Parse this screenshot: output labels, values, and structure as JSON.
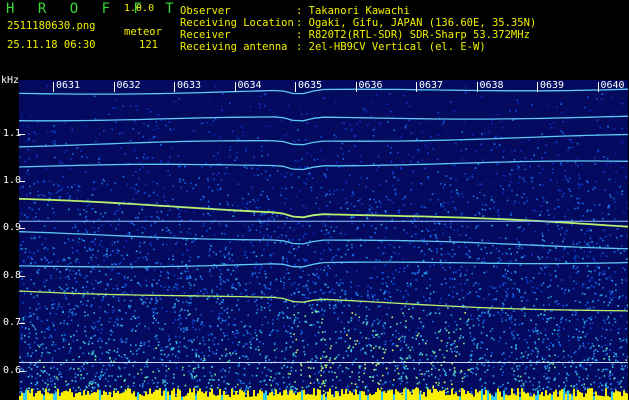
{
  "app": {
    "title": "HROFFT",
    "version": "1.0.0"
  },
  "file": {
    "name": "2511180630.png",
    "timestamp": "25.11.18 06:30"
  },
  "detection": {
    "mode_label": "meteor",
    "count": "121"
  },
  "info": [
    {
      "key": "Observer",
      "value": ": Takanori Kawachi"
    },
    {
      "key": "Receiving Location",
      "value": ": Ogaki, Gifu, JAPAN (136.60E, 35.35N)"
    },
    {
      "key": "Receiver",
      "value": ": R820T2(RTL-SDR) SDR-Sharp 53.372MHz"
    },
    {
      "key": "Receiving antenna",
      "value": ": 2el-HB9CV Vertical (el. E-W)"
    }
  ],
  "colors": {
    "background": "#000000",
    "header_green": "#38d838",
    "header_yellow": "#f0f000",
    "spectrum_low": "#0a1fa0",
    "spectrum_high": "#ffff40"
  },
  "chart_data": {
    "type": "heatmap",
    "ylabel": "kHz",
    "x_ticks": [
      "0631",
      "0632",
      "0633",
      "0634",
      "0635",
      "0636",
      "0637",
      "0638",
      "0639",
      "0640"
    ],
    "y_ticks": [
      "1.1",
      "1.0",
      "0.9",
      "0.8",
      "0.7",
      "0.6"
    ],
    "ylim": [
      0.58,
      1.19
    ],
    "grid": false,
    "traces_khz": [
      {
        "x": [
          0,
          10
        ],
        "y": [
          1.185,
          1.195
        ]
      },
      {
        "x": [
          0,
          10
        ],
        "y": [
          1.13,
          1.135
        ]
      },
      {
        "x": [
          0,
          10
        ],
        "y": [
          1.075,
          1.095
        ]
      },
      {
        "x": [
          0,
          10
        ],
        "y": [
          1.03,
          1.04
        ]
      },
      {
        "x": [
          0,
          10
        ],
        "y": [
          0.96,
          0.905
        ]
      },
      {
        "x": [
          0,
          10
        ],
        "y": [
          0.89,
          0.86
        ]
      },
      {
        "x": [
          0,
          10
        ],
        "y": [
          0.82,
          0.83
        ]
      },
      {
        "x": [
          0,
          10
        ],
        "y": [
          0.77,
          0.725
        ]
      }
    ]
  }
}
